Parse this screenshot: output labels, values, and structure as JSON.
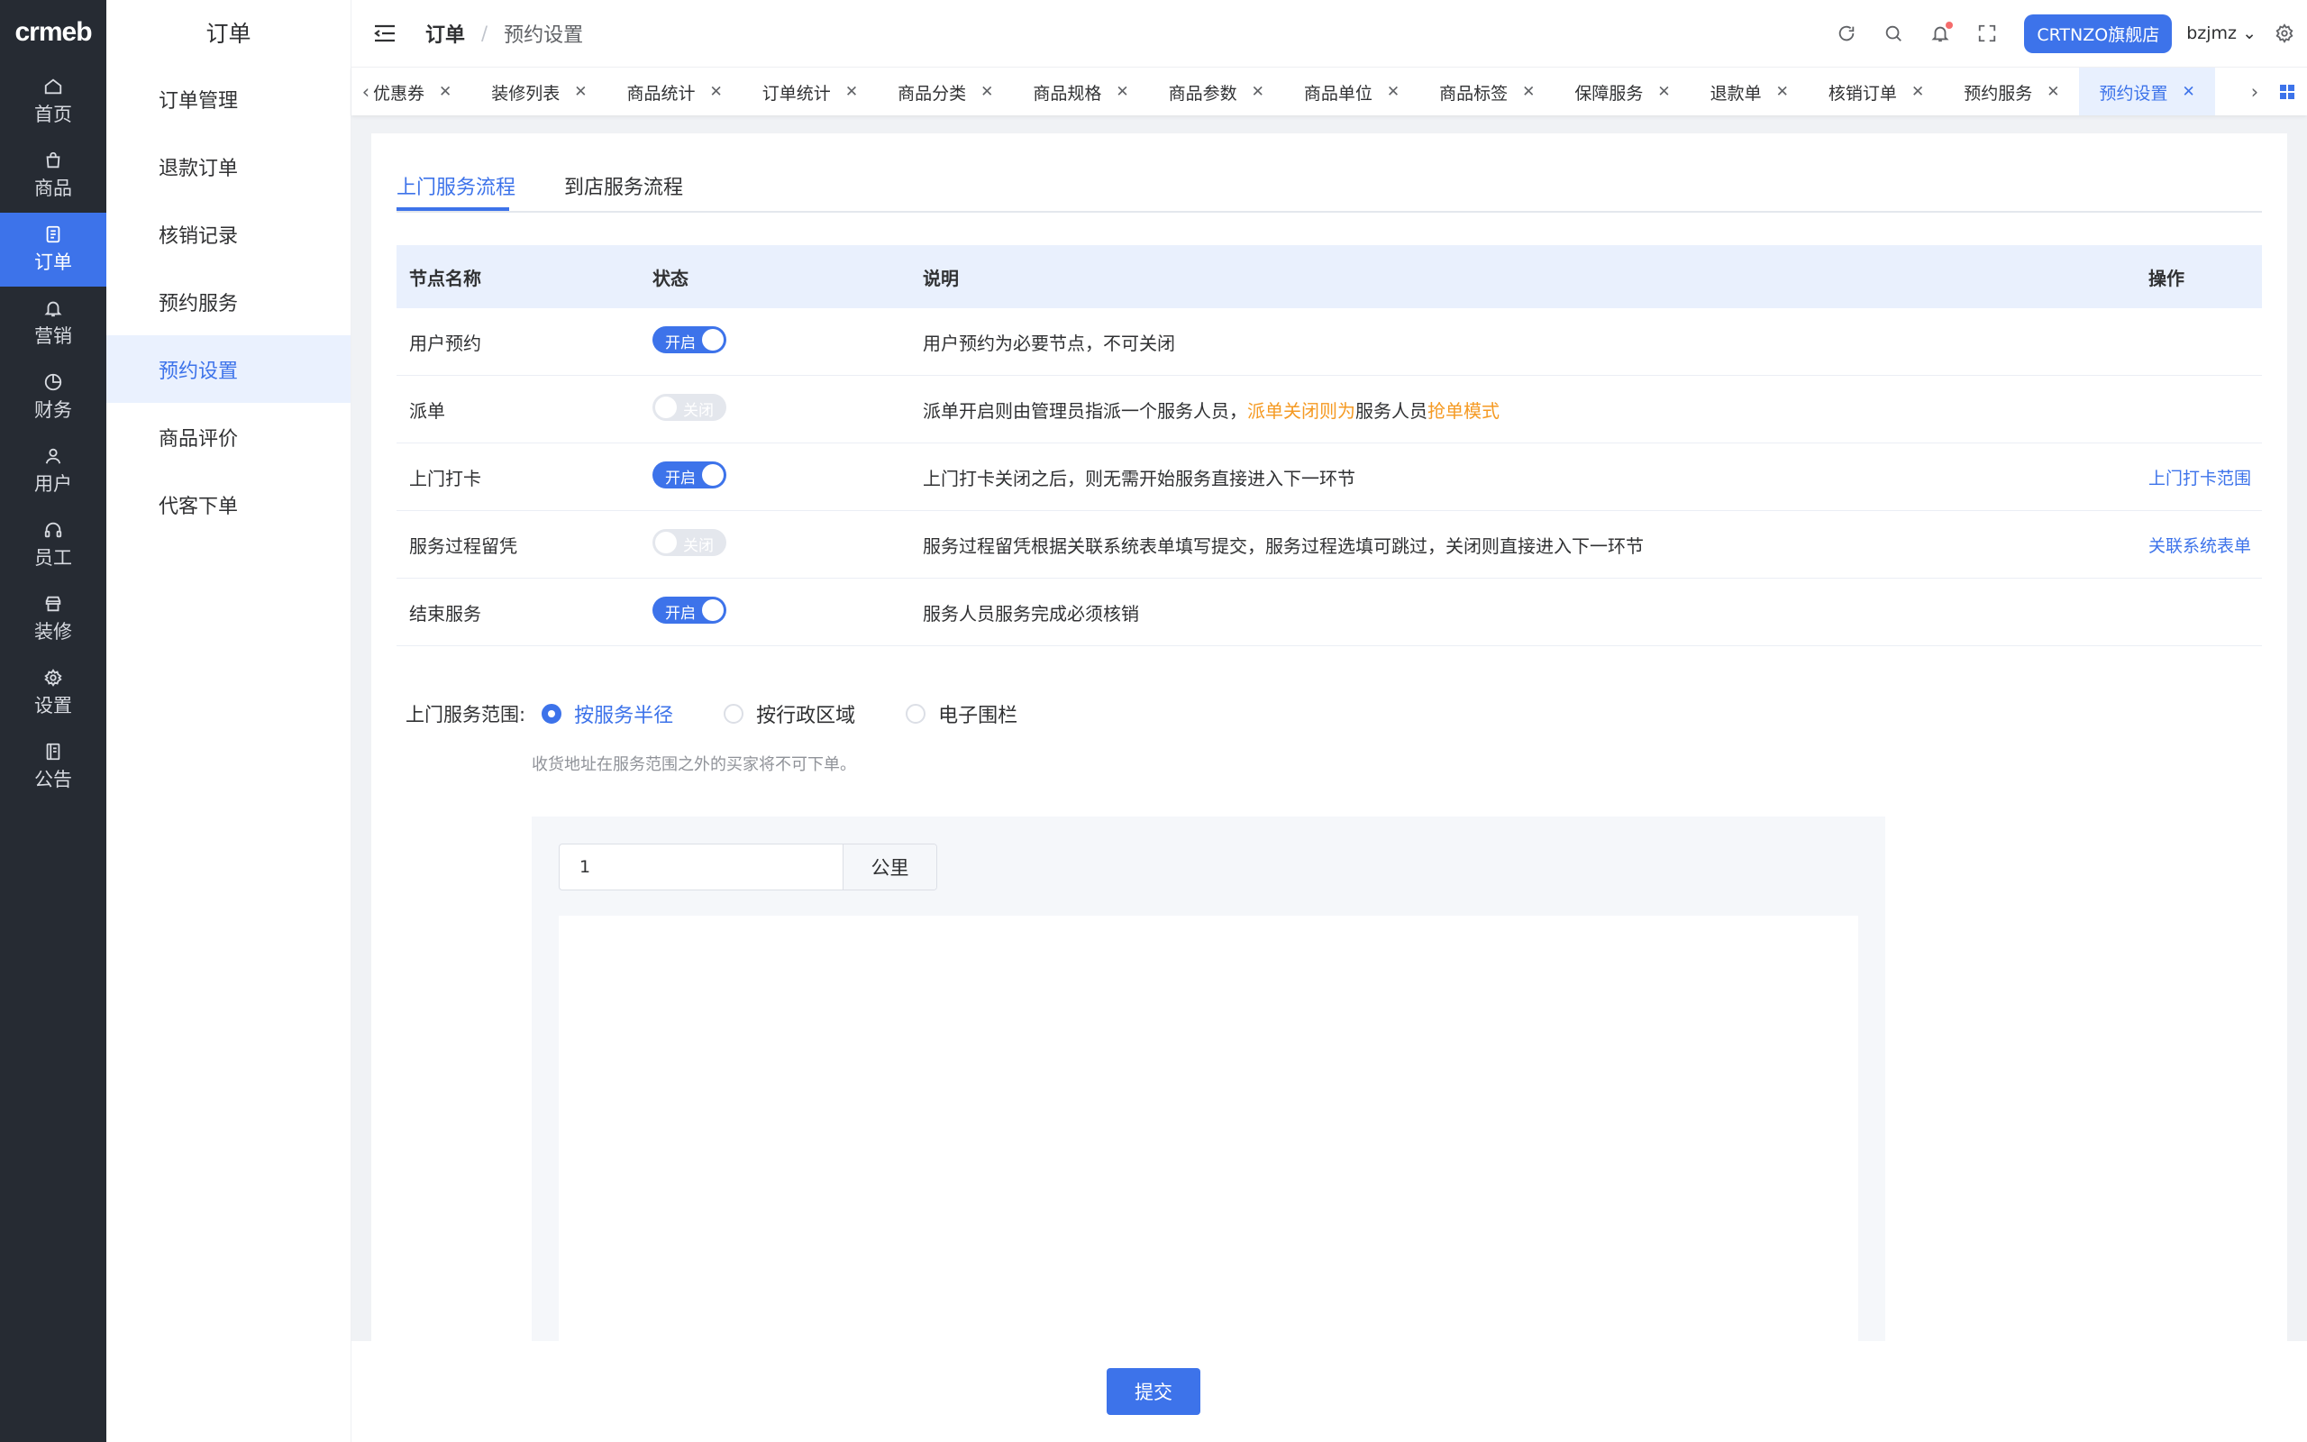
{
  "brand": {
    "logo_text": "crmeb",
    "accent": "#3d73ea",
    "warning": "#f59a23"
  },
  "rail": {
    "items": [
      {
        "label": "首页",
        "icon": "home-icon"
      },
      {
        "label": "商品",
        "icon": "bag-icon"
      },
      {
        "label": "订单",
        "icon": "document-icon",
        "active": true
      },
      {
        "label": "营销",
        "icon": "bell-icon"
      },
      {
        "label": "财务",
        "icon": "pie-chart-icon"
      },
      {
        "label": "用户",
        "icon": "user-icon"
      },
      {
        "label": "员工",
        "icon": "headset-icon"
      },
      {
        "label": "装修",
        "icon": "storefront-icon"
      },
      {
        "label": "设置",
        "icon": "gear-icon"
      },
      {
        "label": "公告",
        "icon": "notice-icon"
      }
    ]
  },
  "submenu": {
    "title": "订单",
    "items": [
      {
        "label": "订单管理"
      },
      {
        "label": "退款订单"
      },
      {
        "label": "核销记录"
      },
      {
        "label": "预约服务"
      },
      {
        "label": "预约设置",
        "active": true
      },
      {
        "label": "商品评价"
      },
      {
        "label": "代客下单"
      }
    ]
  },
  "header": {
    "breadcrumb_main": "订单",
    "breadcrumb_sep": "/",
    "breadcrumb_sub": "预约设置",
    "store_button": "CRTNZO旗舰店",
    "user_name": "bzjmz"
  },
  "tabs": [
    {
      "label": "优惠券"
    },
    {
      "label": "装修列表"
    },
    {
      "label": "商品统计"
    },
    {
      "label": "订单统计"
    },
    {
      "label": "商品分类"
    },
    {
      "label": "商品规格"
    },
    {
      "label": "商品参数"
    },
    {
      "label": "商品单位"
    },
    {
      "label": "商品标签"
    },
    {
      "label": "保障服务"
    },
    {
      "label": "退款单"
    },
    {
      "label": "核销订单"
    },
    {
      "label": "预约服务"
    },
    {
      "label": "预约设置",
      "active": true
    }
  ],
  "inner_tabs": {
    "home_service": "上门服务流程",
    "store_service": "到店服务流程"
  },
  "table": {
    "headers": {
      "name": "节点名称",
      "status": "状态",
      "desc": "说明",
      "action": "操作"
    },
    "switch_on": "开启",
    "switch_off": "关闭",
    "rows": [
      {
        "name": "用户预约",
        "on": true,
        "desc": "用户预约为必要节点，不可关闭",
        "action": ""
      },
      {
        "name": "派单",
        "on": false,
        "desc_a": "派单开启则由管理员指派一个服务人员，",
        "desc_b": "派单关闭则为",
        "desc_c": "服务人员",
        "desc_d": "抢单模式",
        "action": ""
      },
      {
        "name": "上门打卡",
        "on": true,
        "desc": "上门打卡关闭之后，则无需开始服务直接进入下一环节",
        "action": "上门打卡范围"
      },
      {
        "name": "服务过程留凭",
        "on": false,
        "desc": "服务过程留凭根据关联系统表单填写提交，服务过程选填可跳过，关闭则直接进入下一环节",
        "action": "关联系统表单"
      },
      {
        "name": "结束服务",
        "on": true,
        "desc": "服务人员服务完成必须核销",
        "action": ""
      }
    ]
  },
  "service_range": {
    "label": "上门服务范围:",
    "options": [
      "按服务半径",
      "按行政区域",
      "电子围栏"
    ],
    "selected": 0,
    "hint": "收货地址在服务范围之外的买家将不可下单。",
    "distance_value": "1",
    "distance_unit": "公里"
  },
  "footer": {
    "submit": "提交"
  }
}
